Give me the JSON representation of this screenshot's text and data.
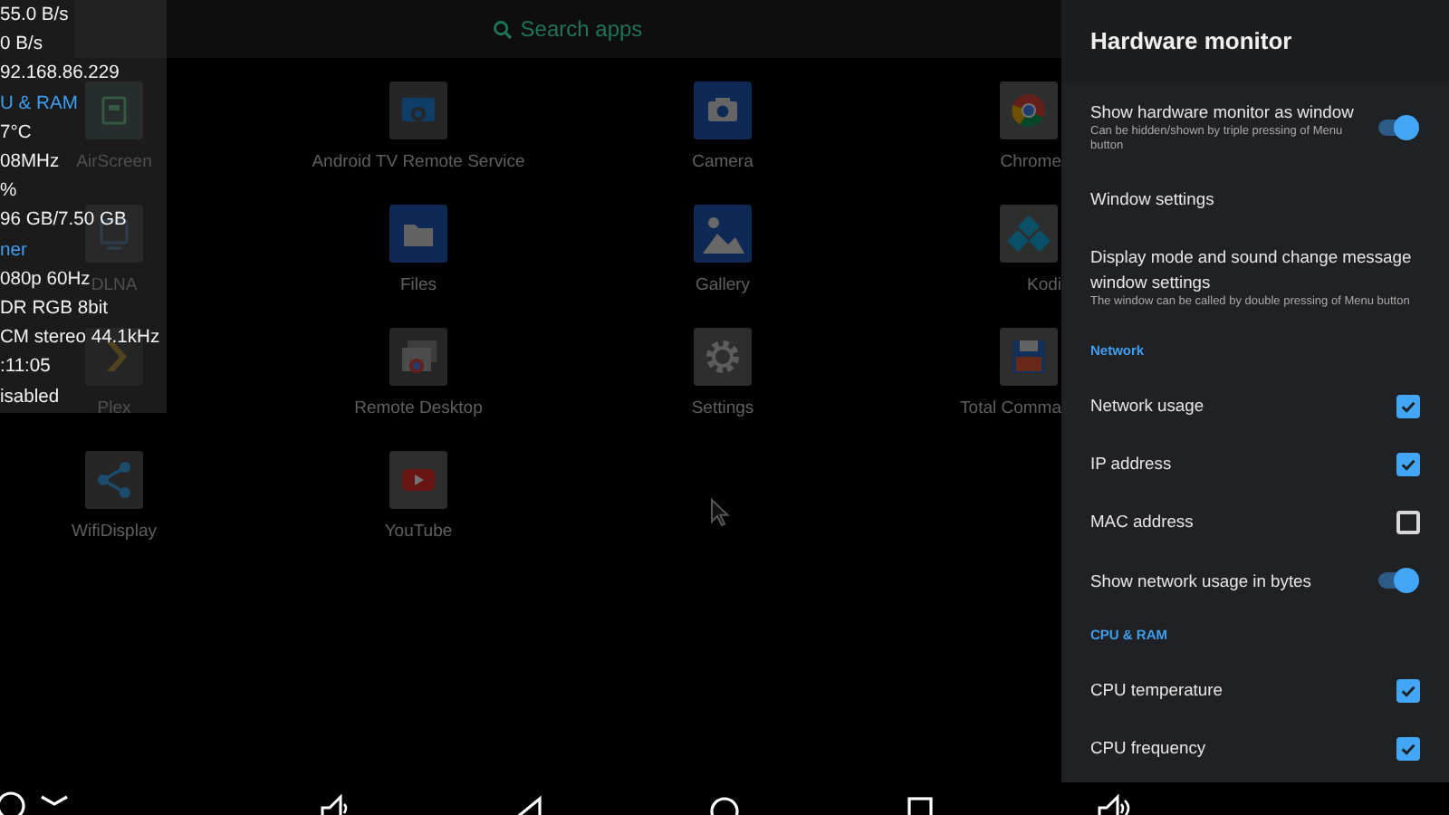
{
  "search": {
    "placeholder": "Search apps"
  },
  "apps": [
    {
      "label": "AirScreen"
    },
    {
      "label": "Android TV Remote Service"
    },
    {
      "label": "Camera"
    },
    {
      "label": "Chrome"
    },
    {
      "label": "DLNA"
    },
    {
      "label": "Files"
    },
    {
      "label": "Gallery"
    },
    {
      "label": "Kodi"
    },
    {
      "label": "Plex"
    },
    {
      "label": "Remote Desktop"
    },
    {
      "label": "Settings"
    },
    {
      "label": "Total Comma"
    },
    {
      "label": "WifiDisplay"
    },
    {
      "label": "YouTube"
    }
  ],
  "monitor_overlay": [
    {
      "kind": "value",
      "text": "55.0 B/s"
    },
    {
      "kind": "value",
      "text": "0 B/s"
    },
    {
      "kind": "value",
      "text": "92.168.86.229"
    },
    {
      "kind": "heading",
      "text": "U & RAM"
    },
    {
      "kind": "value",
      "text": "7°C"
    },
    {
      "kind": "value",
      "text": "08MHz"
    },
    {
      "kind": "value",
      "text": "%"
    },
    {
      "kind": "value",
      "text": "96 GB/7.50 GB"
    },
    {
      "kind": "heading",
      "text": "ner"
    },
    {
      "kind": "value",
      "text": "080p 60Hz"
    },
    {
      "kind": "value",
      "text": "DR RGB 8bit"
    },
    {
      "kind": "value",
      "text": "CM stereo 44.1kHz"
    },
    {
      "kind": "value",
      "text": ":11:05"
    },
    {
      "kind": "value",
      "text": "isabled"
    }
  ],
  "settings_panel": {
    "title": "Hardware monitor",
    "items": [
      {
        "kind": "switch",
        "title": "Show hardware monitor as window",
        "summary": "Can be hidden/shown by triple pressing of Menu button",
        "on": true
      },
      {
        "kind": "link",
        "title": "Window settings"
      },
      {
        "kind": "link",
        "title": "Display mode and sound change message window settings",
        "summary": "The window can be called by double pressing of Menu button"
      },
      {
        "kind": "category",
        "title": "Network"
      },
      {
        "kind": "checkbox",
        "title": "Network usage",
        "checked": true
      },
      {
        "kind": "checkbox",
        "title": "IP address",
        "checked": true
      },
      {
        "kind": "checkbox",
        "title": "MAC address",
        "checked": false
      },
      {
        "kind": "switch",
        "title": "Show network usage in bytes",
        "on": true
      },
      {
        "kind": "category",
        "title": "CPU & RAM"
      },
      {
        "kind": "checkbox",
        "title": "CPU temperature",
        "checked": true
      },
      {
        "kind": "checkbox",
        "title": "CPU frequency",
        "checked": true
      }
    ]
  }
}
